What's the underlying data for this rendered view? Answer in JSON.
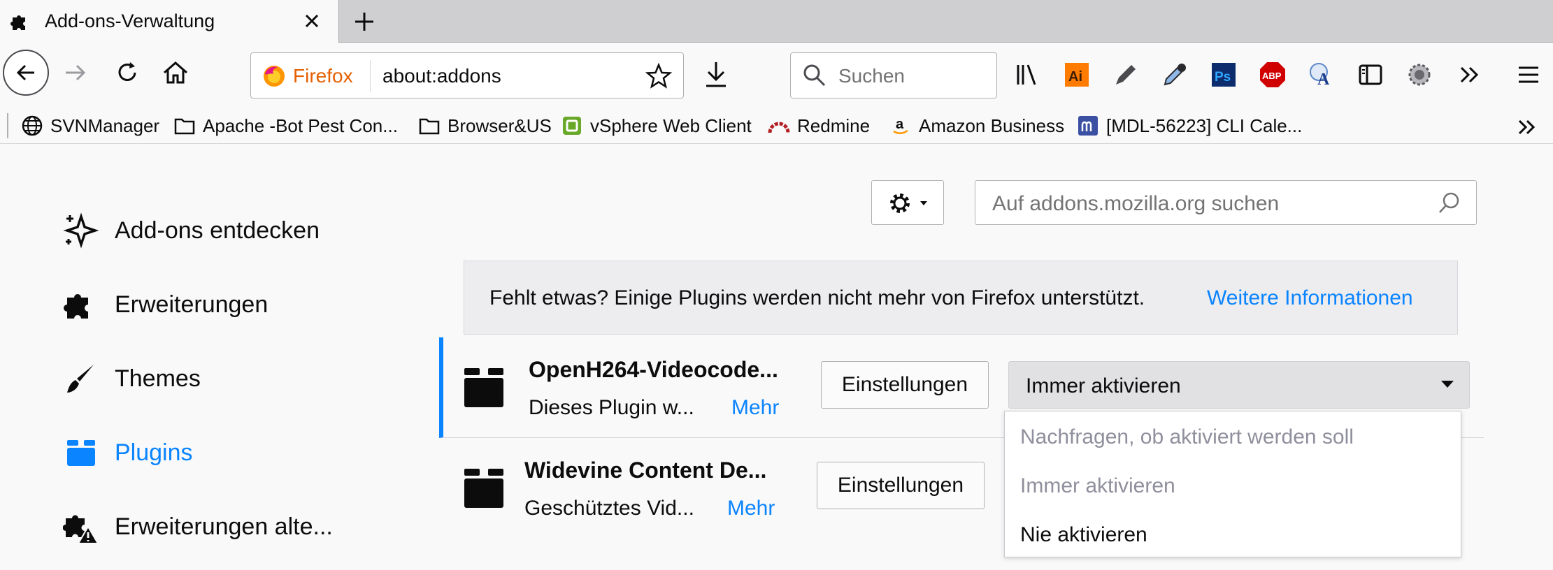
{
  "tab": {
    "title": "Add-ons-Verwaltung",
    "icon": "puzzle-icon"
  },
  "urlbar": {
    "identity": "Firefox",
    "url": "about:addons"
  },
  "search": {
    "placeholder": "Suchen"
  },
  "toolbar_icons": [
    "library-icon",
    "adobe-illustrator-icon",
    "pencil-icon",
    "eyedropper-icon",
    "photoshop-icon",
    "adblock-plus-icon",
    "translate-icon",
    "sidebar-icon",
    "settings-gear-icon",
    "overflow-chevron-icon",
    "hamburger-menu-icon"
  ],
  "bookmarks": [
    {
      "label": "SVNManager",
      "icon": "globe-icon"
    },
    {
      "label": "Apache -Bot Pest Con...",
      "icon": "folder-icon"
    },
    {
      "label": "Browser&US",
      "icon": "folder-icon"
    },
    {
      "label": "vSphere Web Client",
      "icon": "vsphere-icon"
    },
    {
      "label": "Redmine",
      "icon": "redmine-icon"
    },
    {
      "label": "Amazon Business",
      "icon": "amazon-icon"
    },
    {
      "label": "[MDL-56223] CLI Cale...",
      "icon": "moodle-icon"
    }
  ],
  "categories": [
    {
      "label": "Add-ons entdecken",
      "icon": "discover-icon"
    },
    {
      "label": "Erweiterungen",
      "icon": "puzzle-icon"
    },
    {
      "label": "Themes",
      "icon": "brush-icon"
    },
    {
      "label": "Plugins",
      "icon": "plugin-icon",
      "selected": true
    },
    {
      "label": "Erweiterungen alte...",
      "icon": "legacy-puzzle-icon"
    }
  ],
  "amo_search": {
    "placeholder": "Auf addons.mozilla.org suchen"
  },
  "notice": {
    "text": "Fehlt etwas? Einige Plugins werden nicht mehr von Firefox unterstützt.",
    "link": "Weitere Informationen"
  },
  "plugins": [
    {
      "name": "OpenH264-Videocode...",
      "desc": "Dieses Plugin w...",
      "more": "Mehr",
      "settings": "Einstellungen",
      "state": "Immer aktivieren"
    },
    {
      "name": "Widevine Content De...",
      "desc": "Geschütztes Vid...",
      "more": "Mehr",
      "settings": "Einstellungen"
    }
  ],
  "dropdown": {
    "options": [
      "Nachfragen, ob aktiviert werden soll",
      "Immer aktivieren",
      "Nie aktivieren"
    ]
  },
  "colors": {
    "accent": "#0a84ff",
    "firefox_orange": "#e66000",
    "text": "#0c0c0d"
  }
}
